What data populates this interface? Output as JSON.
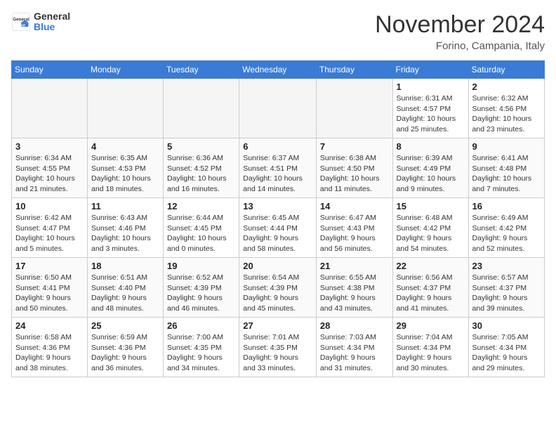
{
  "header": {
    "logo_general": "General",
    "logo_blue": "Blue",
    "month_title": "November 2024",
    "location": "Forino, Campania, Italy"
  },
  "weekdays": [
    "Sunday",
    "Monday",
    "Tuesday",
    "Wednesday",
    "Thursday",
    "Friday",
    "Saturday"
  ],
  "weeks": [
    [
      {
        "day": "",
        "info": ""
      },
      {
        "day": "",
        "info": ""
      },
      {
        "day": "",
        "info": ""
      },
      {
        "day": "",
        "info": ""
      },
      {
        "day": "",
        "info": ""
      },
      {
        "day": "1",
        "info": "Sunrise: 6:31 AM\nSunset: 4:57 PM\nDaylight: 10 hours\nand 25 minutes."
      },
      {
        "day": "2",
        "info": "Sunrise: 6:32 AM\nSunset: 4:56 PM\nDaylight: 10 hours\nand 23 minutes."
      }
    ],
    [
      {
        "day": "3",
        "info": "Sunrise: 6:34 AM\nSunset: 4:55 PM\nDaylight: 10 hours\nand 21 minutes."
      },
      {
        "day": "4",
        "info": "Sunrise: 6:35 AM\nSunset: 4:53 PM\nDaylight: 10 hours\nand 18 minutes."
      },
      {
        "day": "5",
        "info": "Sunrise: 6:36 AM\nSunset: 4:52 PM\nDaylight: 10 hours\nand 16 minutes."
      },
      {
        "day": "6",
        "info": "Sunrise: 6:37 AM\nSunset: 4:51 PM\nDaylight: 10 hours\nand 14 minutes."
      },
      {
        "day": "7",
        "info": "Sunrise: 6:38 AM\nSunset: 4:50 PM\nDaylight: 10 hours\nand 11 minutes."
      },
      {
        "day": "8",
        "info": "Sunrise: 6:39 AM\nSunset: 4:49 PM\nDaylight: 10 hours\nand 9 minutes."
      },
      {
        "day": "9",
        "info": "Sunrise: 6:41 AM\nSunset: 4:48 PM\nDaylight: 10 hours\nand 7 minutes."
      }
    ],
    [
      {
        "day": "10",
        "info": "Sunrise: 6:42 AM\nSunset: 4:47 PM\nDaylight: 10 hours\nand 5 minutes."
      },
      {
        "day": "11",
        "info": "Sunrise: 6:43 AM\nSunset: 4:46 PM\nDaylight: 10 hours\nand 3 minutes."
      },
      {
        "day": "12",
        "info": "Sunrise: 6:44 AM\nSunset: 4:45 PM\nDaylight: 10 hours\nand 0 minutes."
      },
      {
        "day": "13",
        "info": "Sunrise: 6:45 AM\nSunset: 4:44 PM\nDaylight: 9 hours\nand 58 minutes."
      },
      {
        "day": "14",
        "info": "Sunrise: 6:47 AM\nSunset: 4:43 PM\nDaylight: 9 hours\nand 56 minutes."
      },
      {
        "day": "15",
        "info": "Sunrise: 6:48 AM\nSunset: 4:42 PM\nDaylight: 9 hours\nand 54 minutes."
      },
      {
        "day": "16",
        "info": "Sunrise: 6:49 AM\nSunset: 4:42 PM\nDaylight: 9 hours\nand 52 minutes."
      }
    ],
    [
      {
        "day": "17",
        "info": "Sunrise: 6:50 AM\nSunset: 4:41 PM\nDaylight: 9 hours\nand 50 minutes."
      },
      {
        "day": "18",
        "info": "Sunrise: 6:51 AM\nSunset: 4:40 PM\nDaylight: 9 hours\nand 48 minutes."
      },
      {
        "day": "19",
        "info": "Sunrise: 6:52 AM\nSunset: 4:39 PM\nDaylight: 9 hours\nand 46 minutes."
      },
      {
        "day": "20",
        "info": "Sunrise: 6:54 AM\nSunset: 4:39 PM\nDaylight: 9 hours\nand 45 minutes."
      },
      {
        "day": "21",
        "info": "Sunrise: 6:55 AM\nSunset: 4:38 PM\nDaylight: 9 hours\nand 43 minutes."
      },
      {
        "day": "22",
        "info": "Sunrise: 6:56 AM\nSunset: 4:37 PM\nDaylight: 9 hours\nand 41 minutes."
      },
      {
        "day": "23",
        "info": "Sunrise: 6:57 AM\nSunset: 4:37 PM\nDaylight: 9 hours\nand 39 minutes."
      }
    ],
    [
      {
        "day": "24",
        "info": "Sunrise: 6:58 AM\nSunset: 4:36 PM\nDaylight: 9 hours\nand 38 minutes."
      },
      {
        "day": "25",
        "info": "Sunrise: 6:59 AM\nSunset: 4:36 PM\nDaylight: 9 hours\nand 36 minutes."
      },
      {
        "day": "26",
        "info": "Sunrise: 7:00 AM\nSunset: 4:35 PM\nDaylight: 9 hours\nand 34 minutes."
      },
      {
        "day": "27",
        "info": "Sunrise: 7:01 AM\nSunset: 4:35 PM\nDaylight: 9 hours\nand 33 minutes."
      },
      {
        "day": "28",
        "info": "Sunrise: 7:03 AM\nSunset: 4:34 PM\nDaylight: 9 hours\nand 31 minutes."
      },
      {
        "day": "29",
        "info": "Sunrise: 7:04 AM\nSunset: 4:34 PM\nDaylight: 9 hours\nand 30 minutes."
      },
      {
        "day": "30",
        "info": "Sunrise: 7:05 AM\nSunset: 4:34 PM\nDaylight: 9 hours\nand 29 minutes."
      }
    ]
  ]
}
